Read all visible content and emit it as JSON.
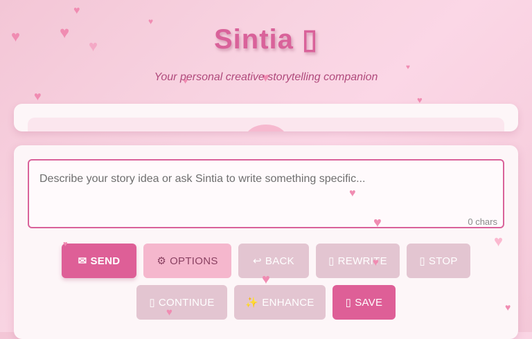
{
  "header": {
    "title": "Sintia",
    "title_icon": "▯",
    "subtitle": "Your personal creative storytelling companion"
  },
  "input": {
    "placeholder": "Describe your story idea or ask Sintia to write something specific...",
    "char_count": "0 chars"
  },
  "buttons": {
    "send": {
      "icon": "✉",
      "label": "SEND"
    },
    "options": {
      "icon": "⚙",
      "label": "OPTIONS"
    },
    "back": {
      "icon": "↩",
      "label": "BACK"
    },
    "rewrite": {
      "icon": "▯",
      "label": "REWRITE"
    },
    "stop": {
      "icon": "▯",
      "label": "STOP"
    },
    "continue": {
      "icon": "▯",
      "label": "CONTINUE"
    },
    "enhance": {
      "icon": "✨",
      "label": "ENHANCE"
    },
    "save": {
      "icon": "▯",
      "label": "SAVE"
    }
  },
  "colors": {
    "accent": "#de5f97",
    "accent_light": "#f5b7cd",
    "muted": "#e3c5d1",
    "background": "#f8d3e1",
    "heart": "#f08cb2"
  }
}
